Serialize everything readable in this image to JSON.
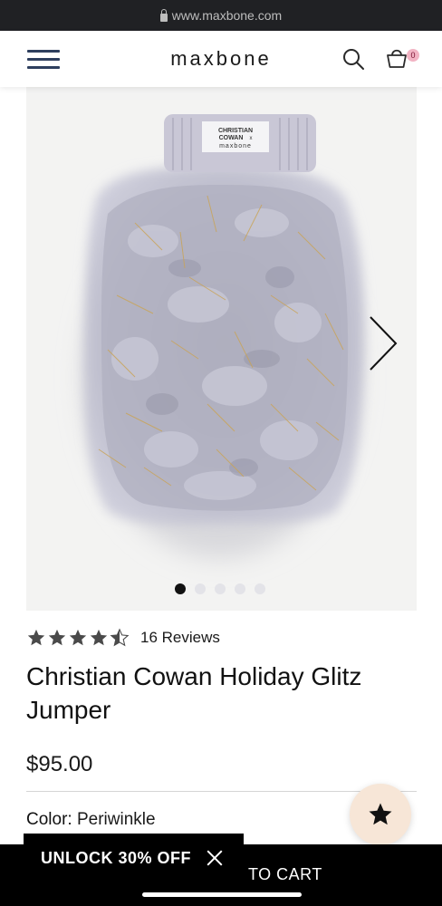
{
  "browser": {
    "url": "www.maxbone.com"
  },
  "header": {
    "logo": "maxbone",
    "cart_count": "0"
  },
  "product": {
    "image_label": {
      "line1": "CHRISTIAN",
      "line2": "COWAN",
      "line3": "x",
      "line4": "maxbone"
    },
    "rating": 4.5,
    "reviews": "16 Reviews",
    "title": "Christian Cowan Holiday Glitz Jumper",
    "price": "$95.00",
    "color_label": "Color:",
    "color_value": "Periwinkle",
    "gallery_total": 5,
    "gallery_active": 1
  },
  "promo": {
    "unlock": "UNLOCK 30% OFF"
  },
  "actions": {
    "to_cart": "TO CART"
  },
  "colors": {
    "accent_nav": "#2e3f5e",
    "fab_bg": "#f7e6d7",
    "badge": "#f2b3c3"
  }
}
